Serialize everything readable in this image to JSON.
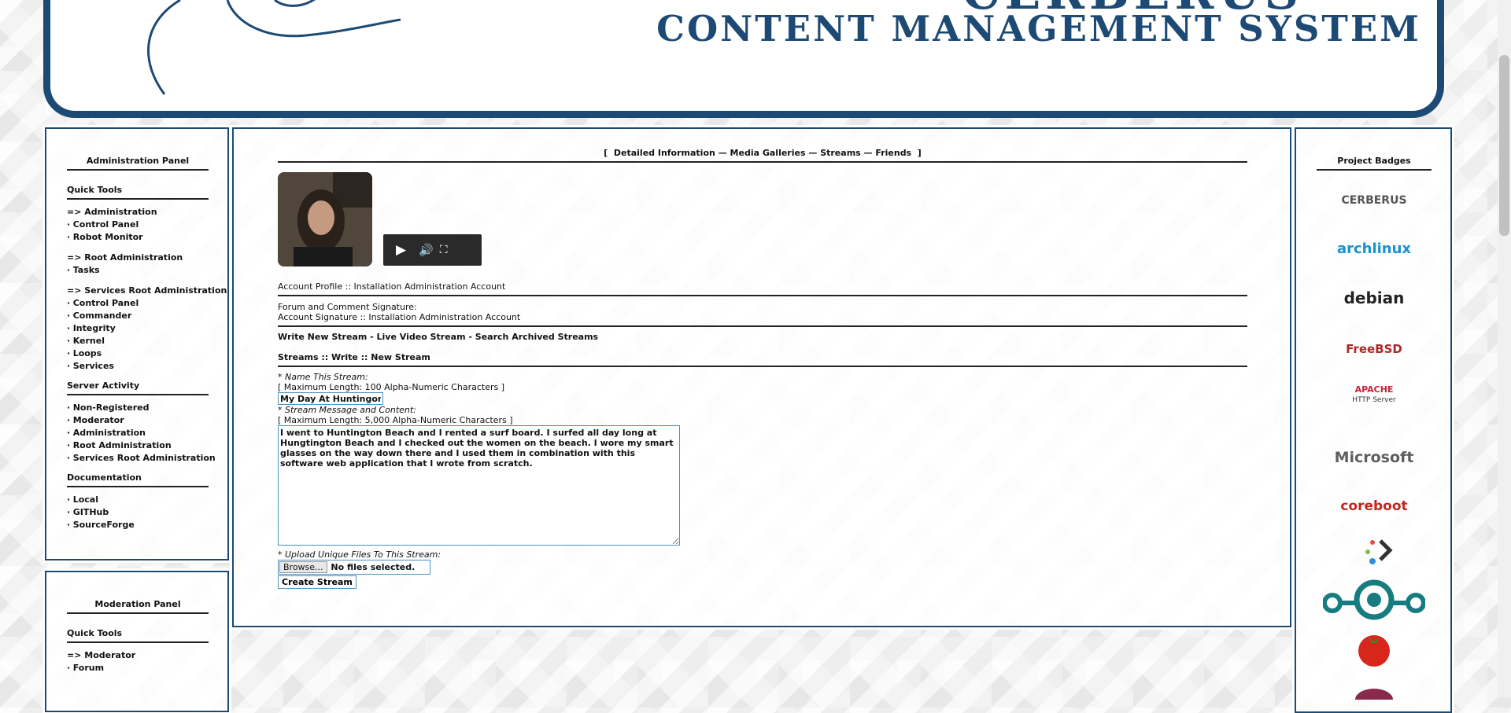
{
  "header": {
    "title_partial": "CERBERUS",
    "subtitle": "CONTENT MANAGEMENT SYSTEM"
  },
  "admin_panel": {
    "title": "Administration Panel",
    "sections": [
      {
        "heading": "Quick Tools",
        "groups": [
          {
            "root": "=> Administration",
            "items": [
              "Control Panel",
              "Robot Monitor"
            ]
          },
          {
            "root": "=> Root Administration",
            "items": [
              "Tasks"
            ]
          },
          {
            "root": "=> Services Root Administration",
            "items": [
              "Control Panel",
              "Commander",
              "Integrity",
              "Kernel",
              "Loops",
              "Services"
            ]
          }
        ]
      },
      {
        "heading": "Server Activity",
        "items": [
          "Non-Registered",
          "Moderator",
          "Administration",
          "Root Administration",
          "Services Root Administration"
        ]
      },
      {
        "heading": "Documentation",
        "items": [
          "Local",
          "GITHub",
          "SourceForge"
        ]
      }
    ]
  },
  "moderation_panel": {
    "title": "Moderation Panel",
    "heading": "Quick Tools",
    "root": "=> Moderator",
    "items": [
      "Forum"
    ]
  },
  "main": {
    "tabs": {
      "open": "[",
      "close": "]",
      "items": [
        "Detailed Information",
        "Media Galleries",
        "Streams",
        "Friends"
      ],
      "separator": "—"
    },
    "account_profile": "Account Profile :: Installation Administration Account",
    "signature_label": "Forum and Comment Signature:",
    "signature_value": "Account Signature :: Installation Administration Account",
    "stream_links": [
      "Write New Stream",
      "Live Video Stream",
      "Search Archived Streams"
    ],
    "stream_links_sep": " - ",
    "breadcrumb": "Streams :: Write :: New Stream",
    "form": {
      "name_label": "* Name This Stream:",
      "name_hint": "[ Maximum Length: 100 Alpha-Numeric Characters ]",
      "name_value": "My Day At Huntingon Be",
      "message_label": "* Stream Message and Content:",
      "message_hint": "[ Maximum Length: 5,000 Alpha-Numeric Characters ]",
      "message_value": "I went to Huntington Beach and I rented a surf board. I surfed all day long at Hungtington Beach and I checked out the women on the beach. I wore my smart glasses on the way down there and I used them in combination with this software web application that I wrote from scratch.",
      "upload_label": "* Upload Unique Files To This Stream:",
      "browse_label": "Browse...",
      "no_files": "No files selected.",
      "submit_label": "Create Stream"
    }
  },
  "badges_panel": {
    "title": "Project Badges",
    "badges": [
      {
        "name": "cerberus",
        "text": "CERBERUS",
        "color": "#555555"
      },
      {
        "name": "archlinux",
        "text": "archlinux",
        "color": "#1793d1"
      },
      {
        "name": "debian",
        "text": "debian",
        "color": "#222222"
      },
      {
        "name": "freebsd",
        "text": "FreeBSD",
        "color": "#ab2b28"
      },
      {
        "name": "apache",
        "text": "APACHE",
        "subtext": "HTTP Server",
        "color": "#c92037"
      },
      {
        "name": "microsoft",
        "text": "Microsoft",
        "color": "#5e5e5e"
      },
      {
        "name": "coreboot",
        "text": "coreboot",
        "color": "#c0281f"
      }
    ]
  },
  "colors": {
    "frame": "#1d4a75",
    "input_border": "#4a90c0"
  }
}
